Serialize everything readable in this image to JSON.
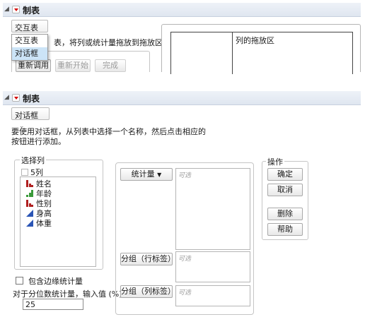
{
  "top_panel": {
    "title": "制表",
    "mode_combo": "交互表",
    "instruction_partial_left": "拖",
    "instruction_partial": "表，将列或统计量拖放到拖放区中。",
    "col_drop_zone": "列的拖放区",
    "menu_items": [
      "交互表",
      "对话框"
    ],
    "buttons": {
      "recall": "重新调用",
      "restart": "重新开始",
      "done": "完成"
    }
  },
  "dialog_panel": {
    "title": "制表",
    "mode_combo": "对话框",
    "instruction_line1": "要使用对话框，从列表中选择一个名称，然后点击相应的",
    "instruction_line2": "按钮进行添加。",
    "select_columns_label": "选择列",
    "column_count": "5列",
    "columns": [
      {
        "name": "姓名",
        "type": "nominal"
      },
      {
        "name": "年龄",
        "type": "ordinal"
      },
      {
        "name": "性别",
        "type": "nominal"
      },
      {
        "name": "身高",
        "type": "continuous"
      },
      {
        "name": "体重",
        "type": "continuous"
      }
    ],
    "role_buttons": {
      "statistics": "统计量",
      "group_rows": "分组（行标签）",
      "group_cols": "分组（列标签）"
    },
    "optional_hint": "可选",
    "include_margin": "包含边缘统计量",
    "quantile_label": "对于分位数统计量，输入值 (%)",
    "quantile_value": "25",
    "actions_label": "操作",
    "actions": {
      "ok": "确定",
      "cancel": "取消",
      "remove": "删除",
      "help": "帮助"
    }
  }
}
